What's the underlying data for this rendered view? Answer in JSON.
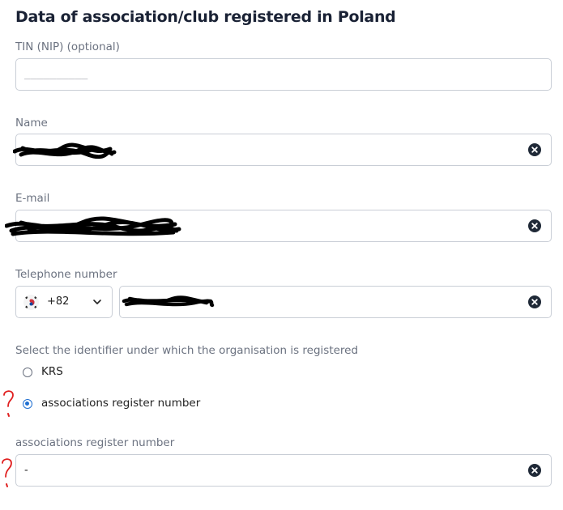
{
  "form": {
    "title": "Data of association/club registered in Poland",
    "tin": {
      "label": "TIN (NIP) (optional)",
      "placeholder": "__________",
      "value": ""
    },
    "name": {
      "label": "Name",
      "value_redacted": true
    },
    "email": {
      "label": "E-mail",
      "value_redacted": true
    },
    "phone": {
      "label": "Telephone number",
      "country_code": "+82",
      "country_flag": "south-korea-flag-icon",
      "value_redacted": true
    },
    "identifier": {
      "label": "Select the identifier under which the organisation is registered",
      "options": [
        {
          "label": "KRS",
          "selected": false
        },
        {
          "label": "associations register number",
          "selected": true
        }
      ]
    },
    "register_number": {
      "label": "associations register number",
      "value": "-"
    }
  },
  "colors": {
    "accent": "#1f6fd1",
    "annotation": "#e02020",
    "border": "#c9ced6",
    "clear_icon": "#1f2937"
  }
}
